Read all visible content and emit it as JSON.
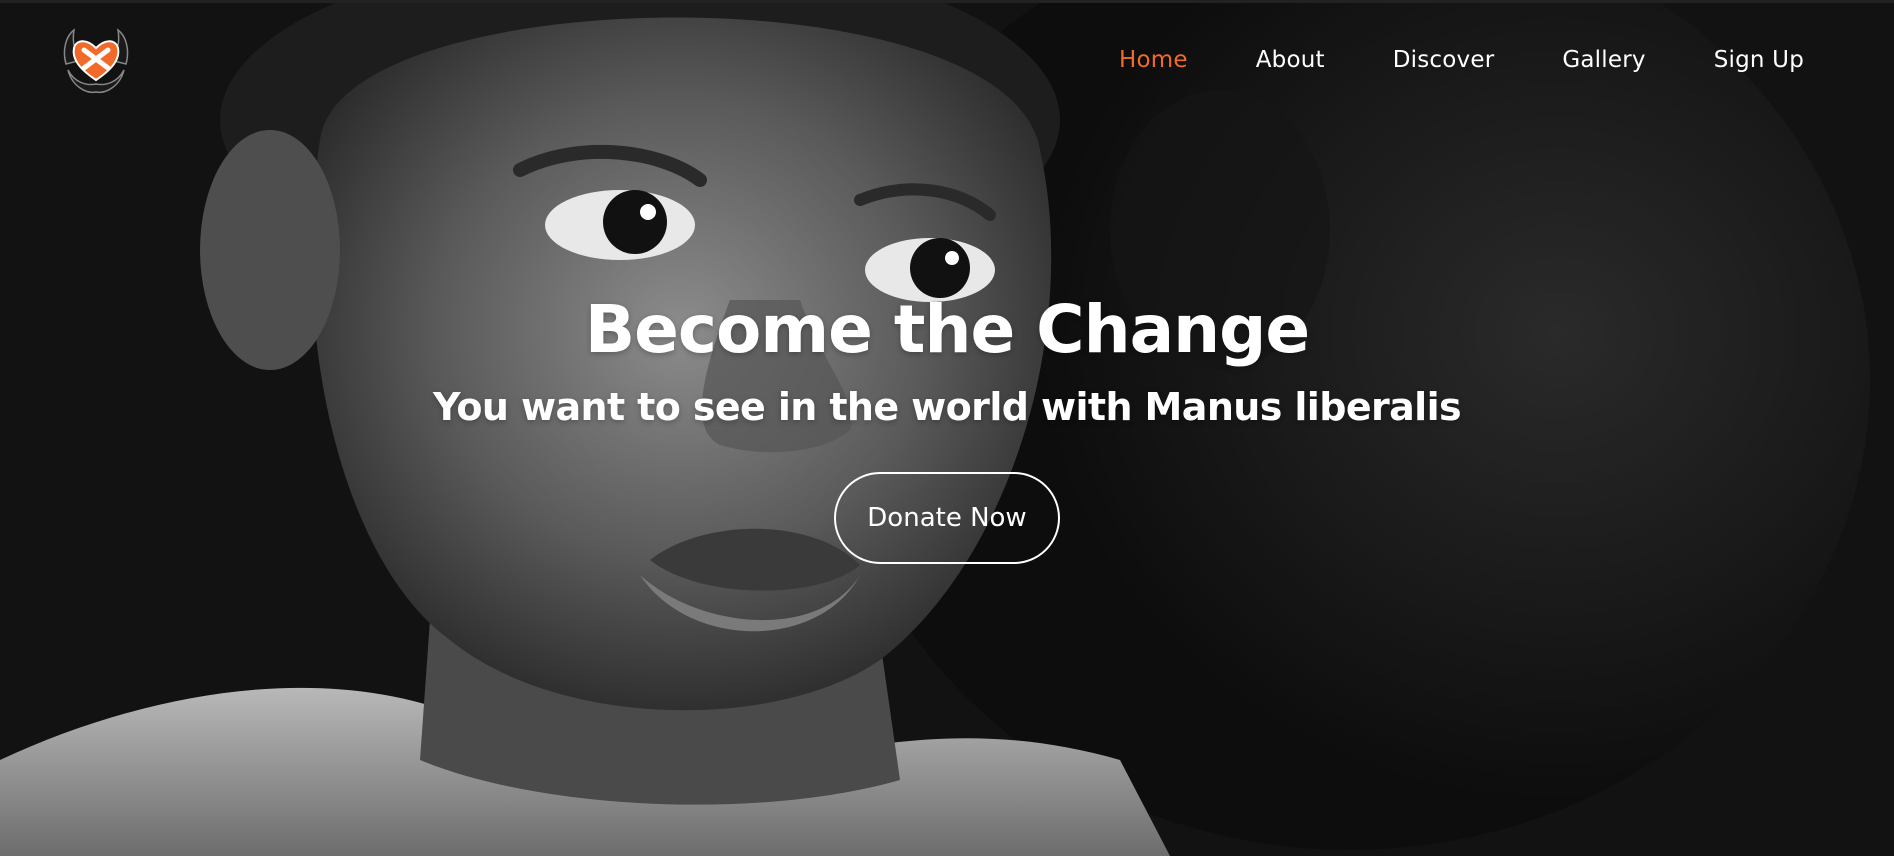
{
  "nav": {
    "items": [
      {
        "label": "Home",
        "active": true
      },
      {
        "label": "About",
        "active": false
      },
      {
        "label": "Discover",
        "active": false
      },
      {
        "label": "Gallery",
        "active": false
      },
      {
        "label": "Sign Up",
        "active": false
      }
    ]
  },
  "logo": {
    "icon": "heart-in-hands-icon"
  },
  "hero": {
    "background_image": "black-and-white-portrait-photo",
    "title": "Become the Change",
    "subtitle": "You want to see in the world with Manus liberalis",
    "cta_label": "Donate Now"
  },
  "colors": {
    "accent": "#f26a2a",
    "text": "#ffffff",
    "button_border": "#ffffff"
  }
}
